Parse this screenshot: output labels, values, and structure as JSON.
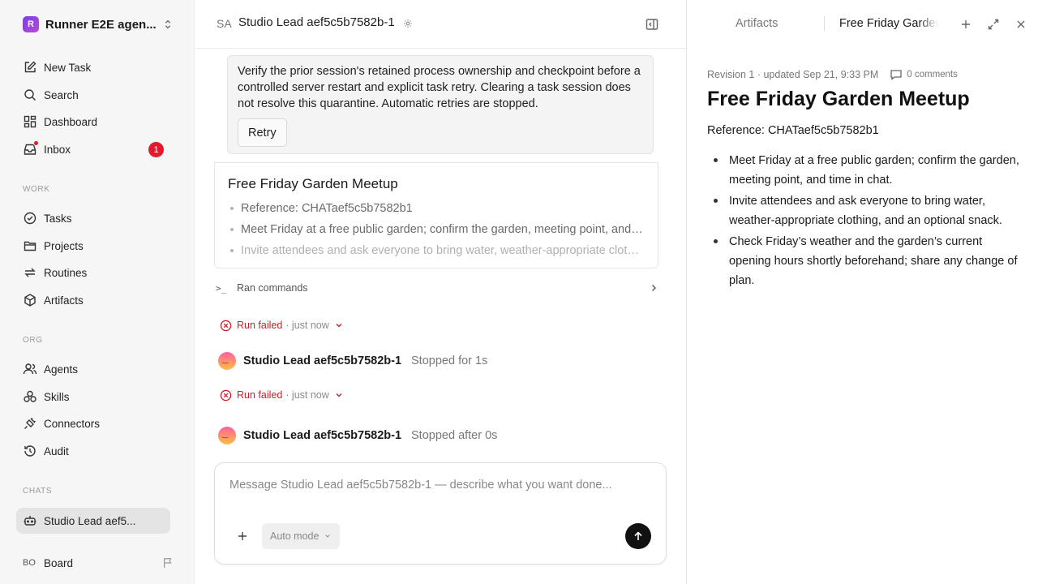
{
  "workspace": {
    "logo_letter": "R",
    "name": "Runner E2E agen..."
  },
  "nav": {
    "main": [
      {
        "label": "New Task",
        "icon": "edit-icon"
      },
      {
        "label": "Search",
        "icon": "search-icon"
      },
      {
        "label": "Dashboard",
        "icon": "dashboard-icon"
      },
      {
        "label": "Inbox",
        "icon": "inbox-icon",
        "badge": "1"
      }
    ],
    "work_heading": "WORK",
    "work": [
      {
        "label": "Tasks",
        "icon": "check-circle-icon"
      },
      {
        "label": "Projects",
        "icon": "folder-icon"
      },
      {
        "label": "Routines",
        "icon": "repeat-icon"
      },
      {
        "label": "Artifacts",
        "icon": "cube-icon"
      }
    ],
    "org_heading": "ORG",
    "org": [
      {
        "label": "Agents",
        "icon": "users-icon"
      },
      {
        "label": "Skills",
        "icon": "skills-icon"
      },
      {
        "label": "Connectors",
        "icon": "plug-icon"
      },
      {
        "label": "Audit",
        "icon": "history-icon"
      }
    ],
    "chats_heading": "CHATS",
    "chats": [
      {
        "label": "Studio Lead aef5...",
        "icon": "bot-icon"
      }
    ],
    "board": {
      "initials": "BO",
      "label": "Board"
    }
  },
  "chat": {
    "initials": "SA",
    "title": "Studio Lead aef5c5b7582b-1",
    "callout_text": "Verify the prior session's retained process ownership and checkpoint before a controlled server restart and explicit task retry. Clearing a task session does not resolve this quarantine. Automatic retries are stopped.",
    "retry_label": "Retry",
    "card": {
      "title": "Free Friday Garden Meetup",
      "items": [
        "Reference: CHATaef5c5b7582b1",
        "Meet Friday at a free public garden; confirm the garden, meeting point, and time in chat.",
        "Invite attendees and ask everyone to bring water, weather-appropriate clothing, and an optional snack."
      ]
    },
    "ran_commands": "Ran commands",
    "events": [
      {
        "status": "Run failed",
        "when": "· just now",
        "agent": "Studio Lead aef5c5b7582b-1",
        "agent_status": "Stopped for 1s"
      },
      {
        "status": "Run failed",
        "when": "· just now",
        "agent": "Studio Lead aef5c5b7582b-1",
        "agent_status": "Stopped after 0s"
      }
    ],
    "composer": {
      "placeholder": "Message Studio Lead aef5c5b7582b-1 — describe what you want done...",
      "mode": "Auto mode"
    }
  },
  "panel": {
    "tab_artifacts": "Artifacts",
    "tab_active": "Free Friday Garden Meetup",
    "meta": "Revision 1 · updated Sep 21, 9:33 PM",
    "comments": "0 comments",
    "doc_title": "Free Friday Garden Meetup",
    "doc_ref": "Reference: CHATaef5c5b7582b1",
    "doc_items": [
      "Meet Friday at a free public garden; confirm the garden, meeting point, and time in chat.",
      "Invite attendees and ask everyone to bring water, weather-appropriate clothing, and an optional snack.",
      "Check Friday’s weather and the garden’s current opening hours shortly beforehand; share any change of plan."
    ]
  }
}
